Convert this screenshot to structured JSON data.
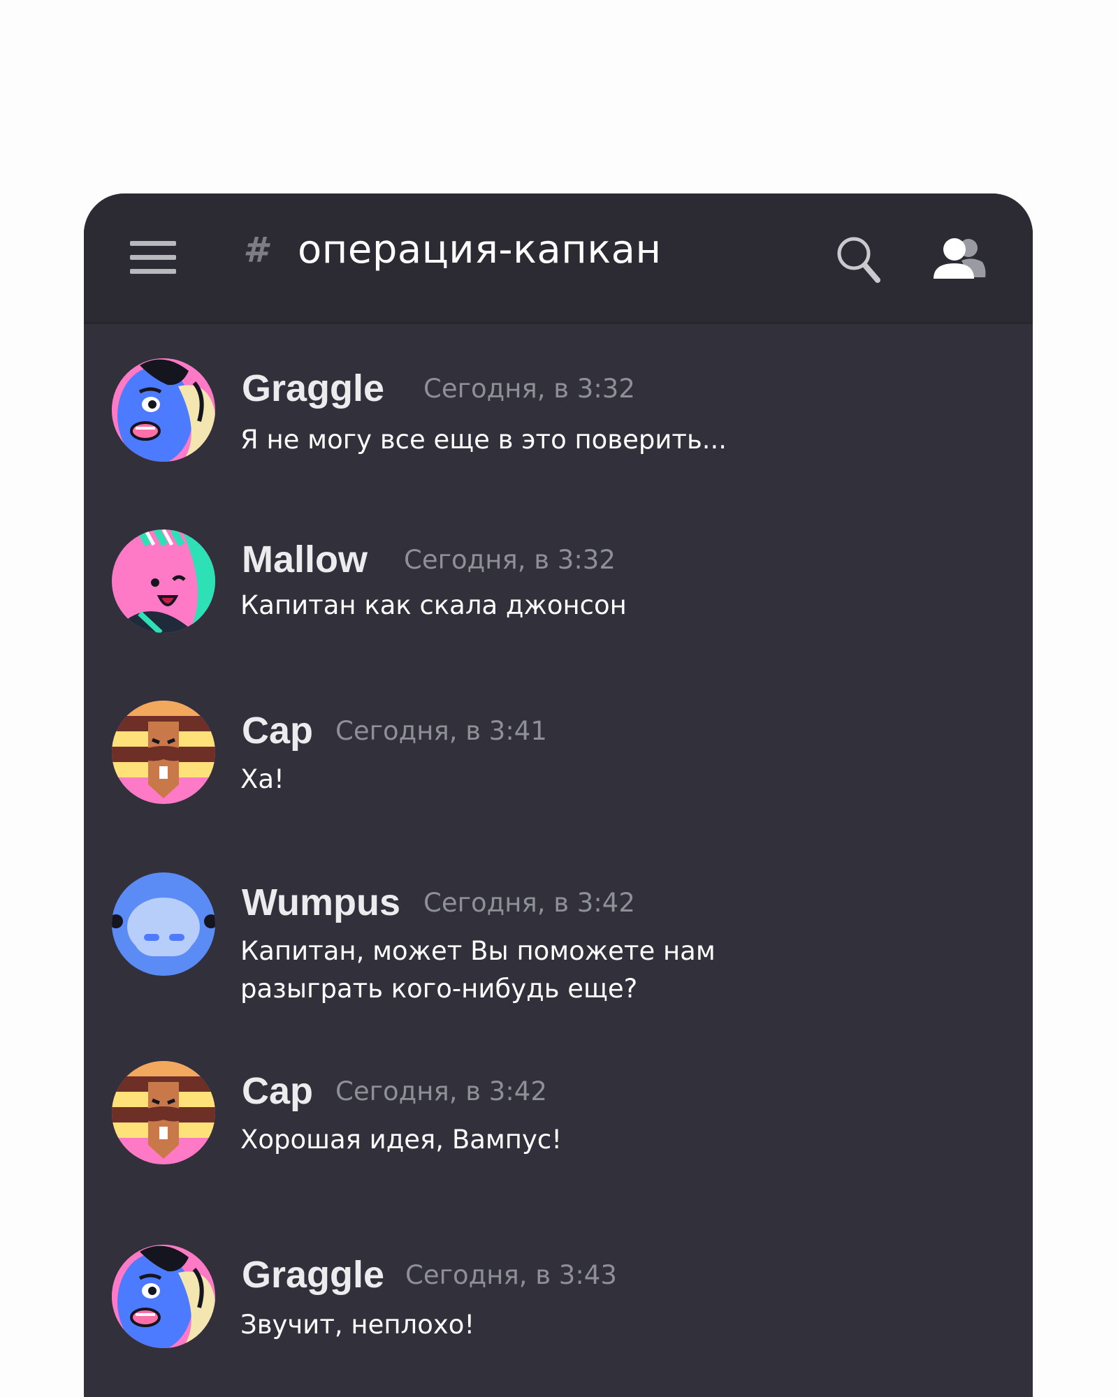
{
  "header": {
    "hash_symbol": "#",
    "channel_name": "операция-капкан",
    "menu_icon": "hamburger-menu-icon",
    "search_icon": "search-icon",
    "members_icon": "members-icon"
  },
  "messages": [
    {
      "author": "Graggle",
      "time": "Сегодня, в 3:32",
      "text": "Я не могу все еще в это поверить...",
      "avatar": "graggle-avatar"
    },
    {
      "author": "Mallow",
      "time": "Сегодня, в 3:32",
      "text": "Капитан как скала джонсон",
      "avatar": "mallow-avatar"
    },
    {
      "author": "Cap",
      "time": "Сегодня, в 3:41",
      "text": "Ха!",
      "avatar": "cap-avatar"
    },
    {
      "author": "Wumpus",
      "time": "Сегодня, в 3:42",
      "text": "Капитан, может Вы поможете нам разыграть кого-нибудь еще?",
      "avatar": "wumpus-avatar"
    },
    {
      "author": "Cap",
      "time": "Сегодня, в 3:42",
      "text": "Хорошая идея, Вампус!",
      "avatar": "cap-avatar"
    },
    {
      "author": "Graggle",
      "time": "Сегодня, в 3:43",
      "text": "Звучит, неплохо!",
      "avatar": "graggle-avatar"
    }
  ],
  "colors": {
    "page_background": "#fdfdfe",
    "chat_background": "#32313b",
    "header_background": "#2c2b33",
    "username": "#ececef",
    "timestamp": "#8f8f98",
    "message_text": "#ffffff"
  }
}
